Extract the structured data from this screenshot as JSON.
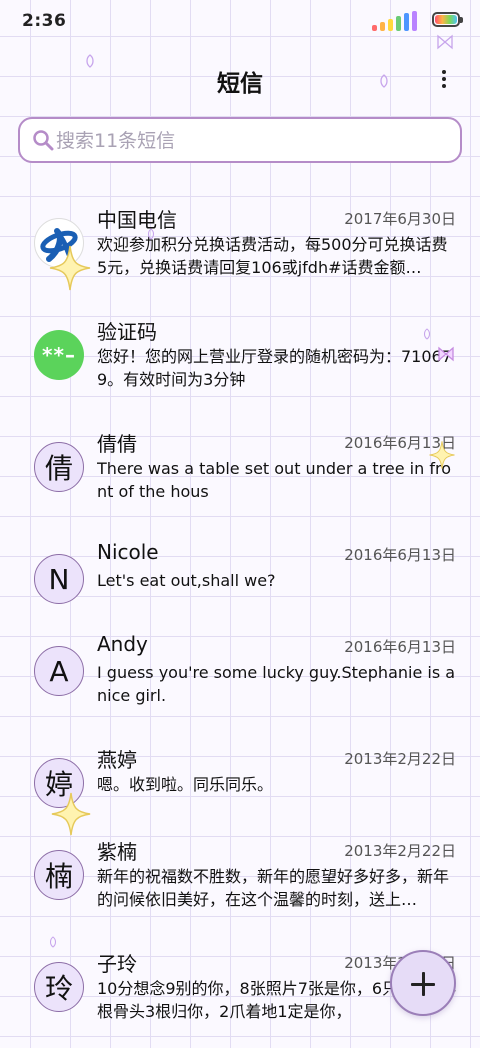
{
  "status_bar": {
    "time": "2:36"
  },
  "header": {
    "title": "短信",
    "more_icon": "more-vert-icon"
  },
  "search": {
    "placeholder": "搜索11条短信",
    "value": "",
    "icon": "search-icon"
  },
  "messages": [
    {
      "name": "中国电信",
      "date": "2017年6月30日",
      "preview": "欢迎参加积分兑换话费活动，每500分可兑换话费5元，兑换话费请回复106或jfdh#话费金额…",
      "avatar": "",
      "avatar_icon": "china-telecom-logo"
    },
    {
      "name": "验证码",
      "date": "",
      "preview": "您好！您的网上营业厅登录的随机密码为：710679。有效时间为3分钟",
      "avatar": "**–",
      "avatar_icon": "verification-code-icon"
    },
    {
      "name": "倩倩",
      "date": "2016年6月13日",
      "preview": "There was a table set out under a tree in front of the hous",
      "avatar": "倩"
    },
    {
      "name": "Nicole",
      "date": "2016年6月13日",
      "preview": "Let's eat out,shall we?",
      "avatar": "N"
    },
    {
      "name": "Andy",
      "date": "2016年6月13日",
      "preview": "I guess you're some lucky guy.Stephanie is a nice girl.",
      "avatar": "A"
    },
    {
      "name": "燕婷",
      "date": "2013年2月22日",
      "preview": "嗯。收到啦。同乐同乐。",
      "avatar": "婷"
    },
    {
      "name": "紫楠",
      "date": "2013年2月22日",
      "preview": "新年的祝福数不胜数，新年的愿望好多好多，新年的问候依旧美好，在这个温馨的时刻，送上…",
      "avatar": "楠"
    },
    {
      "name": "子玲",
      "date": "2013年2月22日",
      "preview": "10分想念9别的你，8张照片7张是你，6只像你，4根骨头3根归你，2爪着地1定是你，",
      "avatar": "玲"
    }
  ],
  "fab": {
    "icon": "plus-icon"
  },
  "colors": {
    "accent": "#b58cc8",
    "avatar_bg": "#ece3fb",
    "grid": "#e2dcf3",
    "verify_green": "#5bd35b"
  }
}
